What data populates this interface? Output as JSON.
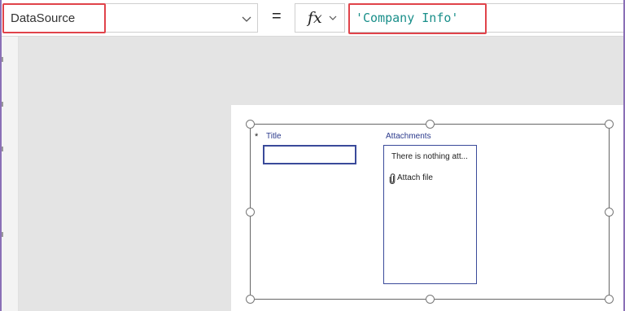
{
  "formula_bar": {
    "property_value": "DataSource",
    "property_chevron_icon": "chevron-down-icon",
    "equals_sign": "=",
    "fx_label": "fx",
    "fx_chevron_icon": "chevron-down-icon",
    "formula_text": "'Company Info'"
  },
  "form": {
    "required_marker": "*",
    "title_label": "Title",
    "title_value": "",
    "attachments_label": "Attachments",
    "attachments_empty_text": "There is nothing att...",
    "attach_file_icon": "paperclip-icon",
    "attach_file_label": "Attach file"
  },
  "colors": {
    "highlight": "#e0434a",
    "formula_text": "#1a8f8a",
    "form_label": "#2b3a8c",
    "canvas_bg": "#e4e4e4",
    "frame_accent": "#8a6fb6"
  }
}
